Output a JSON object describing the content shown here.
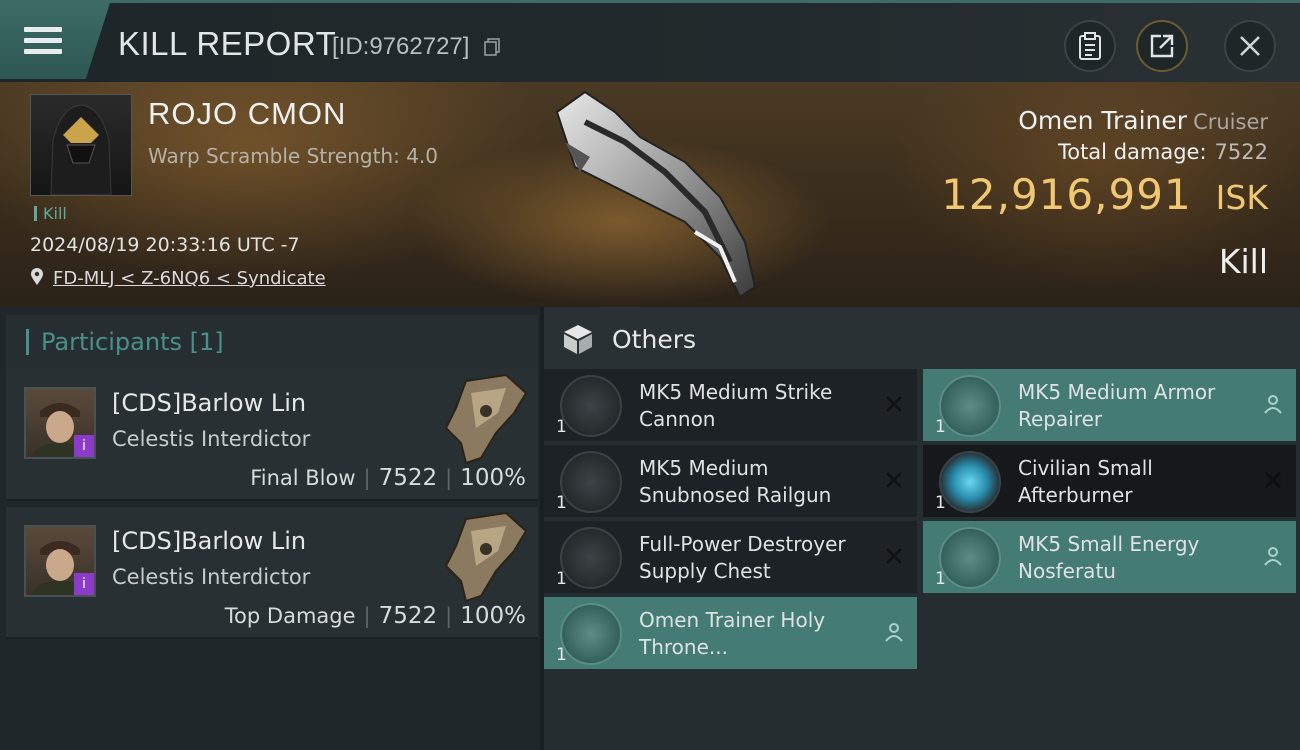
{
  "header": {
    "title": "KILL REPORT",
    "report_id": "[ID:9762727]"
  },
  "victim": {
    "name": "ROJO CMON",
    "warp_scramble": "Warp Scramble Strength: 4.0",
    "tag": "Kill",
    "datetime": "2024/08/19 20:33:16 UTC -7",
    "location": "FD-MLJ < Z-6NQ6 < Syndicate",
    "ship_name": "Omen Trainer",
    "ship_class": "Cruiser",
    "total_damage_label": "Total damage:",
    "total_damage_value": "7522",
    "isk_value": "12,916,991",
    "isk_unit": "ISK",
    "result": "Kill"
  },
  "participants": {
    "title": "Participants [1]",
    "rows": [
      {
        "name": "[CDS]Barlow Lin",
        "ship": "Celestis Interdictor",
        "role": "Final Blow",
        "damage": "7522",
        "percent": "100%",
        "badge": "i"
      },
      {
        "name": "[CDS]Barlow Lin",
        "ship": "Celestis Interdictor",
        "role": "Top Damage",
        "damage": "7522",
        "percent": "100%",
        "badge": "i"
      }
    ]
  },
  "others": {
    "title": "Others",
    "items": [
      {
        "name": "MK5 Medium Strike Cannon",
        "qty": "1",
        "status": "destroyed"
      },
      {
        "name": "MK5 Medium Armor Repairer",
        "qty": "1",
        "status": "dropped"
      },
      {
        "name": "MK5 Medium Snubnosed Railgun",
        "qty": "1",
        "status": "destroyed"
      },
      {
        "name": "Civilian Small Afterburner",
        "qty": "1",
        "status": "destroyed"
      },
      {
        "name": "Full-Power Destroyer Supply Chest",
        "qty": "1",
        "status": "destroyed"
      },
      {
        "name": "MK5 Small Energy Nosferatu",
        "qty": "1",
        "status": "dropped"
      },
      {
        "name": "Omen Trainer Holy Throne...",
        "qty": "1",
        "status": "dropped"
      }
    ]
  },
  "colors": {
    "accent_teal": "#447b74",
    "isk_gold": "#f0c874",
    "badge_purple": "#8b3bc9"
  },
  "icons": [
    "menu-icon",
    "copy-icon",
    "clipboard-icon",
    "share-icon",
    "close-icon",
    "location-pin-icon",
    "box-icon",
    "destroyed-x-icon",
    "dropped-person-icon"
  ]
}
